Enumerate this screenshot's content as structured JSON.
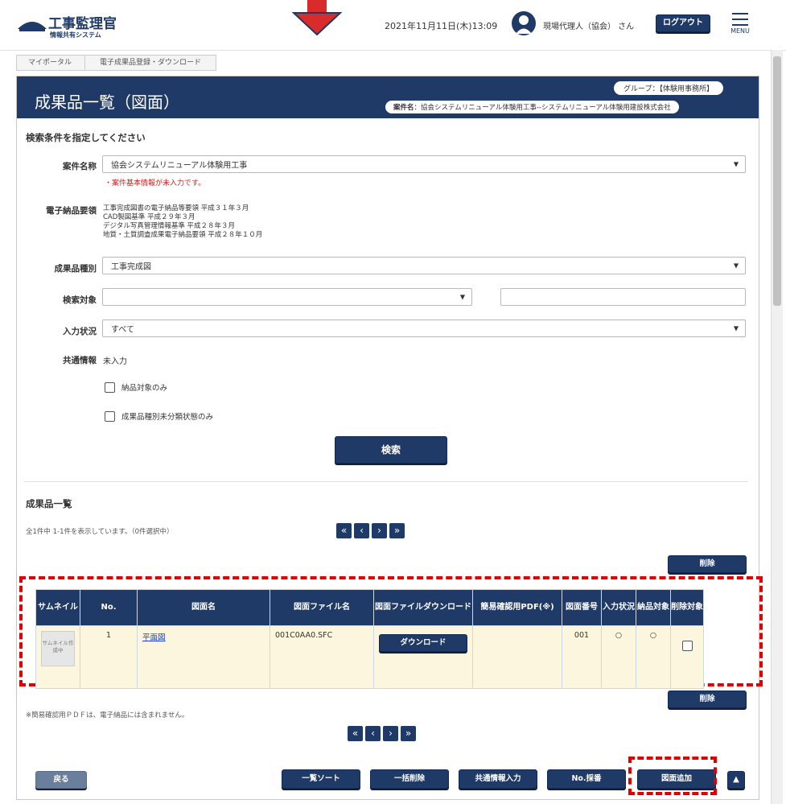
{
  "header": {
    "logo_title": "工事監理官",
    "logo_sub": "情報共有システム",
    "datetime": "2021年11月11日(木)13:09",
    "user": "現場代理人（協会） さん",
    "logout": "ログアウト",
    "menu": "MENU"
  },
  "breadcrumb": [
    "マイポータル",
    "電子成果品登録・ダウンロード"
  ],
  "page": {
    "title": "成果品一覧（図面）",
    "group": "グループ：【体験用事務所】",
    "project_label": "案件名",
    "project": "：協会システムリニューアル体験用工事--システムリニューアル体験用建設株式会社"
  },
  "search": {
    "heading": "検索条件を指定してください",
    "project_name_label": "案件名称",
    "project_name_value": "協会システムリニューアル体験用工事",
    "project_warning": "・案件基本情報が未入力です。",
    "guideline_label": "電子納品要領",
    "guidelines": [
      "工事完成図書の電子納品等要領 平成３１年３月",
      "CAD製図基準 平成２９年３月",
      "デジタル写真管理情報基準 平成２８年３月",
      "地質・土質調査成果電子納品要領 平成２８年１０月"
    ],
    "type_label": "成果品種別",
    "type_value": "工事完成図",
    "target_label": "検索対象",
    "target_value": "",
    "target_text": "",
    "status_label": "入力状況",
    "status_value": "すべて",
    "common_label": "共通情報",
    "common_value": "未入力",
    "check1": "納品対象のみ",
    "check2": "成果品種別未分類状態のみ",
    "search_button": "検索"
  },
  "results": {
    "heading": "成果品一覧",
    "count_text": "全1件中 1-1件を表示しています。（0件選択中）",
    "delete_button": "削除",
    "columns": [
      "サムネイル",
      "No.",
      "図面名",
      "図面ファイル名",
      "図面ファイルダウンロード",
      "簡易確認用PDF(※)",
      "図面番号",
      "入力状況",
      "納品対象",
      "削除対象"
    ],
    "rows": [
      {
        "thumb": "サムネイル作成中",
        "no": "1",
        "name": "平面図",
        "file": "001C0AA0.SFC",
        "download": "ダウンロード",
        "pdf": "",
        "number": "001",
        "input": "○",
        "delivery": "○"
      }
    ],
    "note": "※簡易確認用ＰＤＦは、電子納品には含まれません。"
  },
  "footer": {
    "back": "戻る",
    "sort": "一覧ソート",
    "bulk_delete": "一括削除",
    "common_input": "共通情報入力",
    "no_assign": "No.採番",
    "add_drawing": "図面追加"
  },
  "colors": {
    "navy": "#1f3a66",
    "annotation": "#e00000",
    "row_bg": "#fbf6dd"
  }
}
